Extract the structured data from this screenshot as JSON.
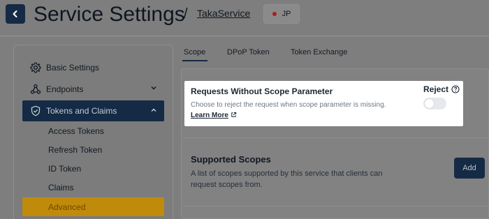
{
  "header": {
    "title": "Service Settings",
    "separator": "/",
    "service_name": "TakaService",
    "region": "JP"
  },
  "sidebar": {
    "items": [
      {
        "label": "Basic Settings",
        "icon": "gear-icon"
      },
      {
        "label": "Endpoints",
        "icon": "webhook-icon"
      },
      {
        "label": "Tokens and Claims",
        "icon": "shield-check-icon"
      }
    ],
    "sub_items": [
      "Access Tokens",
      "Refresh Token",
      "ID Token",
      "Claims"
    ],
    "active_sub_item": "Advanced"
  },
  "tabs": [
    "Scope",
    "DPoP Token",
    "Token Exchange"
  ],
  "requests_without_scope": {
    "title": "Requests Without Scope Parameter",
    "description": "Choose to reject the request when scope parameter is missing.",
    "link": "Learn More",
    "reject_label": "Reject",
    "reject_enabled": false
  },
  "supported_scopes": {
    "title": "Supported Scopes",
    "description": "A list of scopes supported by this service that clients can request scopes from.",
    "add_label": "Add"
  },
  "colors": {
    "navy": "#152a44",
    "accent_gold": "#c08a0a",
    "region_dot": "#a8201a"
  }
}
